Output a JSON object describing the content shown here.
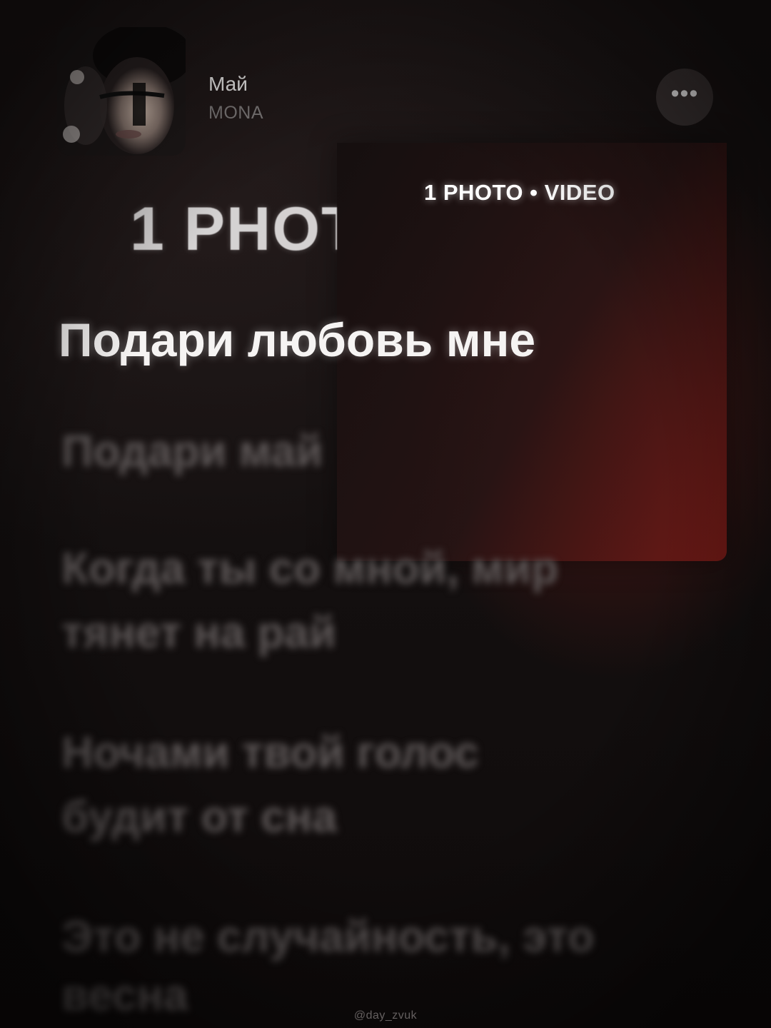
{
  "player": {
    "track_title": "Май",
    "artist": "MONA",
    "more_button_label": "•••"
  },
  "overlay": {
    "photo_video_label": "1 PHOTO • VIDEO",
    "big_label": "1 PHOT"
  },
  "lyrics": {
    "current": "Подари любовь мне",
    "next": [
      "Подари май",
      "Когда ты со мной, мир",
      "тянет на рай",
      "Ночами твой голос",
      "будит от сна",
      "Это не случайность, это",
      "весна"
    ]
  },
  "watermark": "@day_zvuk",
  "colors": {
    "background": "#110d0d",
    "accent_red": "#781c18",
    "text_primary": "#f6f4f3",
    "text_dim": "#5e5858"
  }
}
